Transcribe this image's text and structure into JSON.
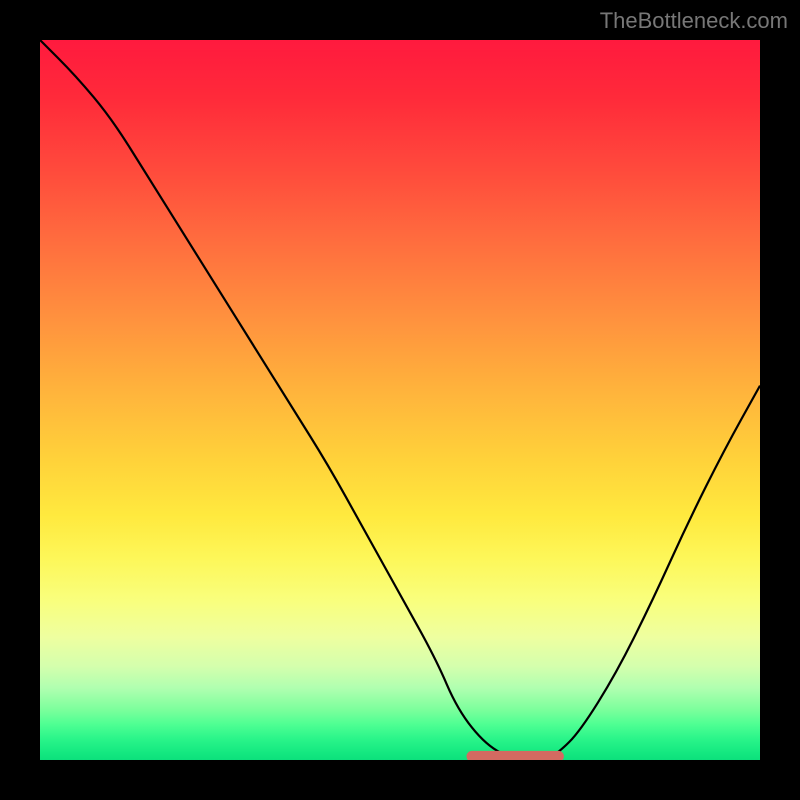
{
  "watermark": "TheBottleneck.com",
  "chart_data": {
    "type": "line",
    "title": "",
    "xlabel": "",
    "ylabel": "",
    "xlim": [
      0,
      100
    ],
    "ylim": [
      0,
      100
    ],
    "grid": false,
    "series": [
      {
        "name": "bottleneck-curve",
        "x": [
          0,
          5,
          10,
          15,
          20,
          25,
          30,
          35,
          40,
          45,
          50,
          55,
          58,
          62,
          66,
          70,
          72,
          75,
          80,
          85,
          90,
          95,
          100
        ],
        "y": [
          100,
          95,
          89,
          81,
          73,
          65,
          57,
          49,
          41,
          32,
          23,
          14,
          7,
          2,
          0,
          0,
          1,
          4,
          12,
          22,
          33,
          43,
          52
        ]
      }
    ],
    "highlight_band": {
      "name": "optimal-range",
      "x_start": 60,
      "x_end": 72,
      "y": 0.5,
      "color": "#d36a61"
    },
    "background_gradient": {
      "top": "#ff1a3e",
      "mid": "#ffd13a",
      "bottom": "#0ce07c"
    }
  }
}
